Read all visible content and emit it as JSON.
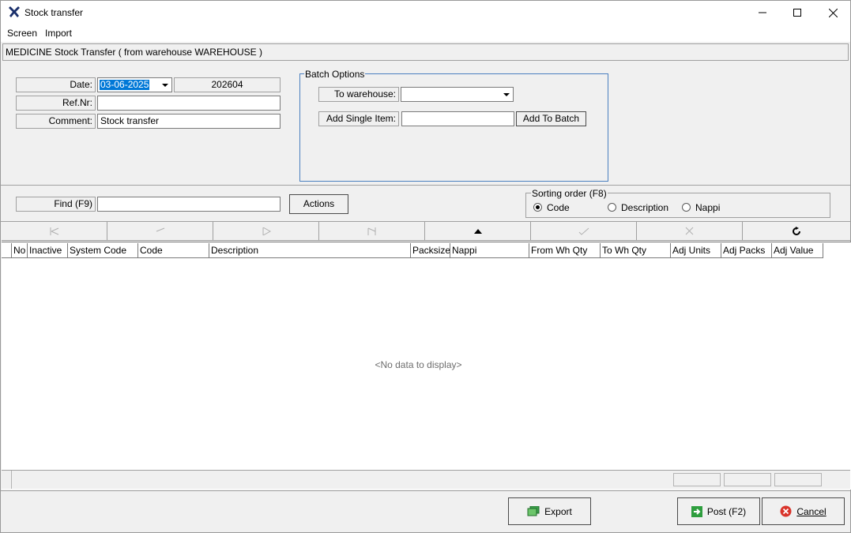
{
  "window": {
    "title": "Stock transfer",
    "menu": [
      "Screen",
      "Import"
    ]
  },
  "header": {
    "caption": "MEDICINE Stock Transfer ( from warehouse WAREHOUSE )"
  },
  "form": {
    "date_label": "Date:",
    "date_value": "03-06-2025",
    "period_value": "202604",
    "ref_label": "Ref.Nr:",
    "ref_value": "",
    "comment_label": "Comment:",
    "comment_value": "Stock transfer"
  },
  "batch": {
    "title": "Batch Options",
    "to_warehouse_label": "To warehouse:",
    "to_warehouse_value": "",
    "add_single_label": "Add Single Item:",
    "add_single_value": "",
    "add_to_batch_label": "Add To Batch"
  },
  "find": {
    "label": "Find (F9)",
    "value": "",
    "actions_label": "Actions"
  },
  "sorting": {
    "title": "Sorting order (F8)",
    "options": [
      "Code",
      "Description",
      "Nappi"
    ],
    "selected": "Code"
  },
  "grid": {
    "columns": [
      "No",
      "Inactive",
      "System Code",
      "Code",
      "Description",
      "Packsize",
      "Nappi",
      "From Wh Qty",
      "To Wh Qty",
      "Adj Units",
      "Adj Packs",
      "Adj Value"
    ],
    "empty_text": "<No data to display>"
  },
  "buttons": {
    "export": "Export",
    "post": "Post (F2)",
    "cancel": "Cancel"
  },
  "colors": {
    "accent_blue": "#0078d7",
    "group_border": "#4a7fbf"
  }
}
